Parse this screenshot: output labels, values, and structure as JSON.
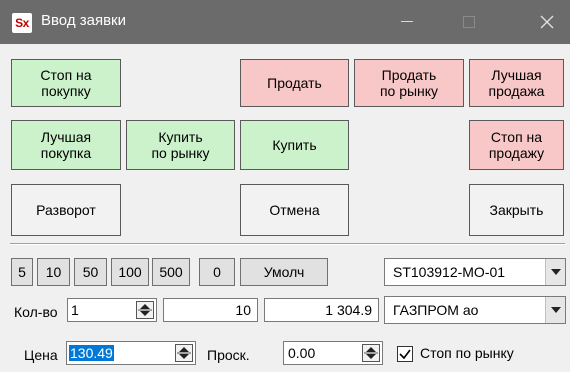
{
  "window": {
    "title": "Ввод заявки",
    "app_icon_text": "Sx",
    "titlebar_color": "#6b6b6b"
  },
  "buttons": {
    "stop_buy": "Стоп на\nпокупку",
    "sell": "Продать",
    "sell_market": "Продать\nпо рынку",
    "best_sell": "Лучшая\nпродажа",
    "best_buy": "Лучшая\nпокупка",
    "buy_market": "Купить\nпо рынку",
    "buy": "Купить",
    "stop_sell": "Стоп на\nпродажу",
    "reverse": "Разворот",
    "cancel": "Отмена",
    "close": "Закрыть"
  },
  "quick_qty": [
    "5",
    "10",
    "50",
    "100",
    "500",
    "0"
  ],
  "default_button": "Умолч",
  "account": {
    "value": "ST103912-MO-01"
  },
  "qty": {
    "label": "Кол-во",
    "value": "1",
    "lots": "10",
    "sum": "1 304.9"
  },
  "instrument": {
    "value": "ГАЗПРОМ ао"
  },
  "price": {
    "label": "Цена",
    "value": "130.49"
  },
  "slippage": {
    "label": "Проск.",
    "value": "0.00"
  },
  "market_stop": {
    "label": "Стоп по рынку",
    "checked": true
  },
  "colors": {
    "buy_green": "#ccf2cc",
    "sell_red": "#f8c8c8",
    "neutral": "#f2f2f2",
    "selection_blue": "#0078d7"
  }
}
